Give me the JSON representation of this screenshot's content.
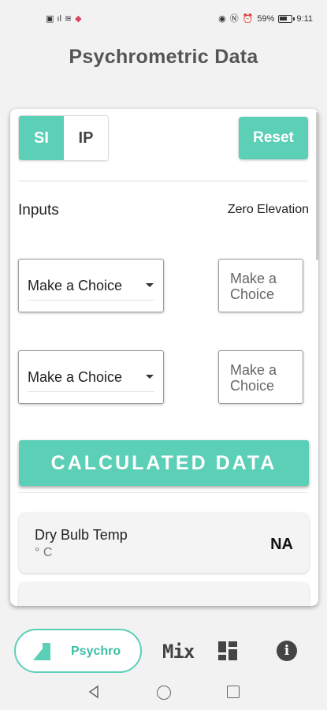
{
  "status_bar": {
    "left_icons": [
      "notification-icon",
      "signal-icon",
      "wifi-icon",
      "shield-icon"
    ],
    "right_icons": [
      "eye-icon",
      "nfc-icon",
      "alarm-icon"
    ],
    "battery": "59%",
    "time": "9:11"
  },
  "page": {
    "title": "Psychrometric Data"
  },
  "units": {
    "si_label": "SI",
    "ip_label": "IP",
    "selected": "SI"
  },
  "reset_label": "Reset",
  "inputs": {
    "label": "Inputs",
    "elevation_label": "Zero Elevation",
    "rows": [
      {
        "select_value": "Make a Choice",
        "value_placeholder": "Make a Choice"
      },
      {
        "select_value": "Make a Choice",
        "value_placeholder": "Make a Choice"
      }
    ]
  },
  "calculated": {
    "banner": "CALCULATED DATA",
    "rows": [
      {
        "name": "Dry Bulb Temp",
        "unit": "° C",
        "value": "NA"
      }
    ]
  },
  "bottom_nav": {
    "psychro_label": "Psychro",
    "mix_label": "Mix"
  },
  "colors": {
    "accent": "#5ccfb7",
    "background": "#f2f2f2"
  }
}
